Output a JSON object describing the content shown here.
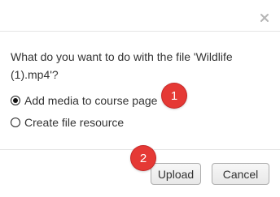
{
  "dialog": {
    "close_icon": "close-icon",
    "question": "What do you want to do with the file 'Wildlife (1).mp4'?",
    "options": [
      {
        "label": "Add media to course page",
        "selected": true
      },
      {
        "label": "Create file resource",
        "selected": false
      }
    ],
    "buttons": {
      "upload": "Upload",
      "cancel": "Cancel"
    }
  },
  "annotations": {
    "step1": "1",
    "step2": "2",
    "badge_color": "#e53935"
  }
}
